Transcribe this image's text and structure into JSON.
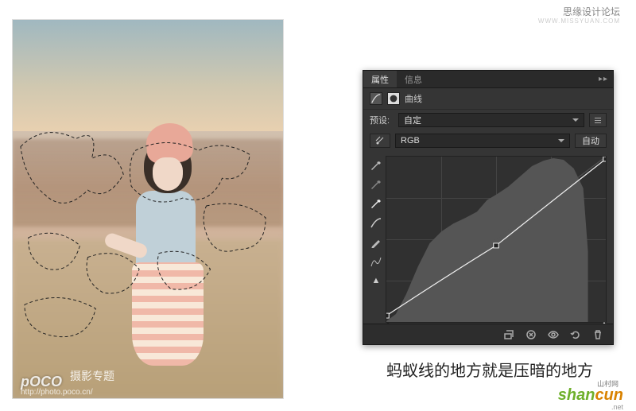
{
  "header": {
    "forum": "思缘设计论坛",
    "forum_url": "WWW.MISSYUAN.COM"
  },
  "photo_watermark": {
    "brand": "pOCO",
    "label": "摄影专题",
    "url": "http://photo.poco.cn/"
  },
  "panel": {
    "tabs": {
      "properties": "属性",
      "info": "信息"
    },
    "menu_hint": "▸▸",
    "adjustment_type": "曲线",
    "preset_label": "预设:",
    "preset_value": "自定",
    "channel_value": "RGB",
    "auto_label": "自动"
  },
  "curve": {
    "points": [
      {
        "in": 0,
        "out": 10
      },
      {
        "in": 128,
        "out": 118
      },
      {
        "in": 255,
        "out": 252
      }
    ],
    "sliders": {
      "black": 0,
      "white": 255
    }
  },
  "caption": "蚂蚁线的地方就是压暗的地方",
  "footer_logo": {
    "text1": "shan",
    "text2": "cun",
    "sub": ".net",
    "cn": "山村网"
  },
  "icons": {
    "eyedropper_black": "eyedropper-black-icon",
    "eyedropper_gray": "eyedropper-gray-icon",
    "eyedropper_white": "eyedropper-white-icon",
    "curve_smooth": "curve-smooth-icon",
    "pencil": "pencil-icon",
    "hand": "hand-icon",
    "warn": "warning-icon",
    "clip_mask": "clip-mask-icon",
    "prev_state": "prev-state-icon",
    "visibility": "visibility-icon",
    "reset": "reset-icon",
    "trash": "trash-icon"
  }
}
